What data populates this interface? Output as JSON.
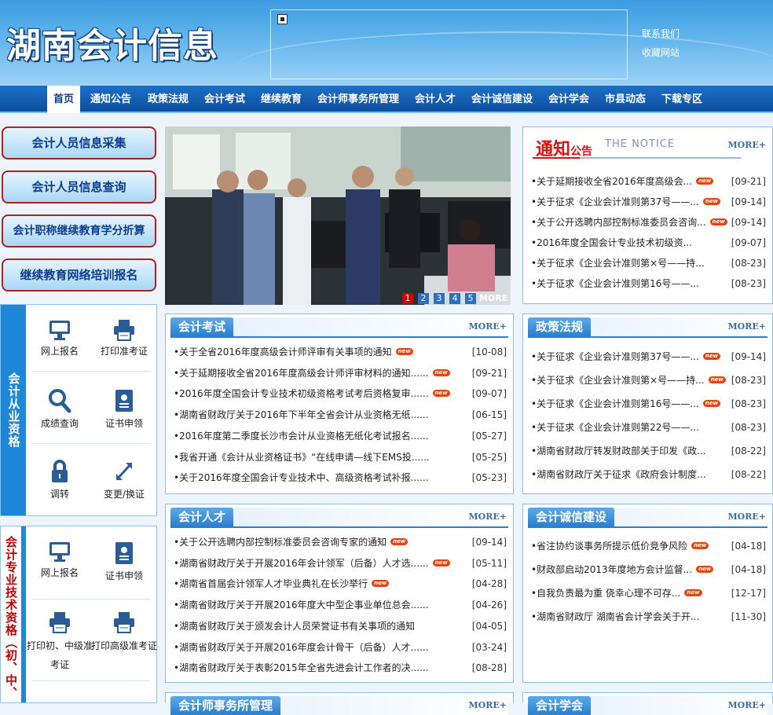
{
  "header": {
    "logo": "湖南会计信息",
    "links": [
      "联系我们",
      "收藏网站"
    ]
  },
  "nav": [
    "首页",
    "通知公告",
    "政策法规",
    "会计考试",
    "继续教育",
    "会计师事务所管理",
    "会计人才",
    "会计诚信建设",
    "会计学会",
    "市县动态",
    "下载专区"
  ],
  "side_buttons": [
    "会计人员信息采集",
    "会计人员信息查询",
    "会计职称继续教育学分折算",
    "继续教育网络培训报名"
  ],
  "box1": {
    "band": "会计从业资格",
    "items": [
      "网上报名",
      "打印准考证",
      "成绩查询",
      "证书申领",
      "调转",
      "变更/换证"
    ]
  },
  "box2": {
    "band": "会计专业技术资格（初、中、高",
    "items": [
      "网上报名",
      "证书申领",
      "打印初、中级准考证",
      "打印高级准考证"
    ]
  },
  "slider": {
    "pages": [
      "1",
      "2",
      "3",
      "4",
      "5"
    ],
    "more": "MORE"
  },
  "notice": {
    "title": "通知",
    "title_small": "公告",
    "title_en": "THE NOTICE",
    "more": "MORE+",
    "rows": [
      {
        "t": "关于延期接收全省2016年度高级会...",
        "d": "[09-21]",
        "new": true
      },
      {
        "t": "关于征求《企业会计准则第37号——...",
        "d": "[09-14]",
        "new": true
      },
      {
        "t": "关于公开选聘内部控制标准委员会咨询...",
        "d": "[09-14]",
        "new": true
      },
      {
        "t": "2016年度全国会计专业技术初级资...",
        "d": "[09-07]",
        "new": false
      },
      {
        "t": "关于征求《企业会计准则第×号——持...",
        "d": "[08-23]",
        "new": false
      },
      {
        "t": "关于征求《企业会计准则第16号——...",
        "d": "[08-23]",
        "new": false
      }
    ]
  },
  "exam": {
    "title": "会计考试",
    "more": "MORE+",
    "rows": [
      {
        "t": "关于全省2016年度高级会计师评审有关事项的通知",
        "d": "[10-08]",
        "new": true
      },
      {
        "t": "关于延期接收全省2016年度高级会计师评审材料的通知......",
        "d": "[09-21]",
        "new": true
      },
      {
        "t": "2016年度全国会计专业技术初级资格考试考后资格复审......",
        "d": "[09-07]",
        "new": true
      },
      {
        "t": "湖南省财政厅关于2016年下半年全省会计从业资格无纸......",
        "d": "[06-15]",
        "new": false
      },
      {
        "t": "2016年度第二季度长沙市会计从业资格无纸化考试报名......",
        "d": "[05-27]",
        "new": false
      },
      {
        "t": "我省开通《会计从业资格证书》“在线申请—线下EMS投......",
        "d": "[05-25]",
        "new": false
      },
      {
        "t": "关于2016年度全国会计专业技术中、高级资格考试补报......",
        "d": "[05-23]",
        "new": false
      }
    ]
  },
  "policy": {
    "title": "政策法规",
    "more": "MORE+",
    "rows": [
      {
        "t": "关于征求《企业会计准则第37号——...",
        "d": "[09-14]",
        "new": true
      },
      {
        "t": "关于征求《企业会计准则第×号——持...",
        "d": "[08-23]",
        "new": true
      },
      {
        "t": "关于征求《企业会计准则第16号——...",
        "d": "[08-23]",
        "new": true
      },
      {
        "t": "关于征求《企业会计准则第22号——...",
        "d": "[08-23]",
        "new": false
      },
      {
        "t": "湖南省财政厅转发财政部关于印发《政...",
        "d": "[08-22]",
        "new": false
      },
      {
        "t": "湖南省财政厅关于征求《政府会计制度...",
        "d": "[08-22]",
        "new": false
      }
    ]
  },
  "talent": {
    "title": "会计人才",
    "more": "MORE+",
    "rows": [
      {
        "t": "关于公开选聘内部控制标准委员会咨询专家的通知",
        "d": "[09-14]",
        "new": true
      },
      {
        "t": "湖南省财政厅关于开展2016年会计领军（后备）人才选......",
        "d": "[05-11]",
        "new": true
      },
      {
        "t": "湖南省首届会计领军人才毕业典礼在长沙举行",
        "d": "[04-28]",
        "new": true
      },
      {
        "t": "湖南省财政厅关于开展2016年度大中型企事业单位总会......",
        "d": "[04-26]",
        "new": false
      },
      {
        "t": "湖南省财政厅关于颁发会计人员荣誉证书有关事项的通知",
        "d": "[04-05]",
        "new": false
      },
      {
        "t": "湖南省财政厅关于开展2016年度会计骨干（后备）人才......",
        "d": "[03-24]",
        "new": false
      },
      {
        "t": "湖南省财政厅关于表彰2015年全省先进会计工作者的决......",
        "d": "[08-28]",
        "new": false
      }
    ]
  },
  "integrity": {
    "title": "会计诚信建设",
    "more": "MORE+",
    "rows": [
      {
        "t": "省注协约谈事务所提示低价竞争风险",
        "d": "[04-18]",
        "new": true
      },
      {
        "t": "财政部启动2013年度地方会计监督...",
        "d": "[04-18]",
        "new": true
      },
      {
        "t": "自我负责最为重  侥幸心理不可存...",
        "d": "[12-17]",
        "new": true
      },
      {
        "t": "湖南省财政厅  湖南省会计学会关于开...",
        "d": "[11-30]",
        "new": false
      }
    ]
  },
  "bottom": {
    "left_title": "会计师事务所管理",
    "right_title": "会计学会",
    "more": "MORE+"
  }
}
